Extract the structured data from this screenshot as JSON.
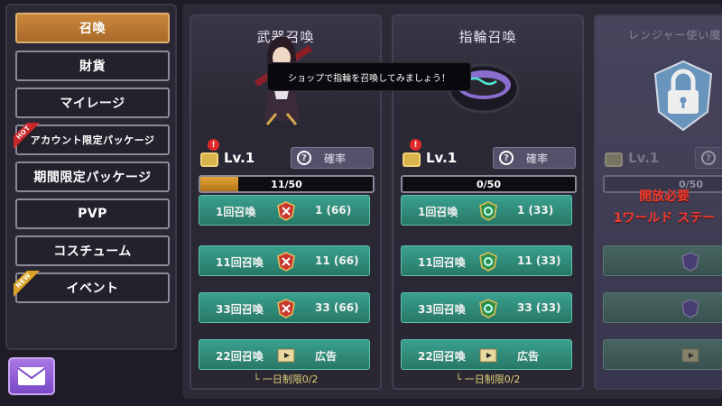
{
  "sidebar": {
    "items": [
      {
        "label": "召喚",
        "active": true
      },
      {
        "label": "財貨"
      },
      {
        "label": "マイレージ"
      },
      {
        "label": "アカウント限定パッケージ",
        "badge": "HOT"
      },
      {
        "label": "期間限定パッケージ"
      },
      {
        "label": "PVP"
      },
      {
        "label": "コスチューム"
      },
      {
        "label": "イベント",
        "badge": "NEW"
      }
    ]
  },
  "mail": {
    "icon": "mail-icon"
  },
  "tooltip": {
    "text": "ショップで指輪を召喚してみましょう！"
  },
  "cards": [
    {
      "title": "武器召喚",
      "level": "Lv.1",
      "rate_label": "確率",
      "progress_text": "11/50",
      "progress_fraction": 0.22,
      "buttons": [
        {
          "label": "1回召喚",
          "cost": "1 (66)",
          "icon": "sword-gem-icon"
        },
        {
          "label": "11回召喚",
          "cost": "11 (66)",
          "icon": "sword-gem-icon"
        },
        {
          "label": "33回召喚",
          "cost": "33 (66)",
          "icon": "sword-gem-icon"
        },
        {
          "label": "22回召喚",
          "cost": "広告",
          "icon": "video-ad-icon"
        }
      ],
      "limit": "└ 一日制限0/2"
    },
    {
      "title": "指輪召喚",
      "level": "Lv.1",
      "rate_label": "確率",
      "progress_text": "0/50",
      "progress_fraction": 0,
      "buttons": [
        {
          "label": "1回召喚",
          "cost": "1 (33)",
          "icon": "ring-gem-icon"
        },
        {
          "label": "11回召喚",
          "cost": "11 (33)",
          "icon": "ring-gem-icon"
        },
        {
          "label": "33回召喚",
          "cost": "33 (33)",
          "icon": "ring-gem-icon"
        },
        {
          "label": "22回召喚",
          "cost": "広告",
          "icon": "video-ad-icon"
        }
      ],
      "limit": "└ 一日制限0/2"
    },
    {
      "title": "レンジャー使い魔",
      "level": "Lv.1",
      "progress_text": "0/50",
      "unlock_line1": "開放必要",
      "unlock_line2": "1ワールド ステー",
      "locked": true
    }
  ],
  "colors": {
    "accent_orange": "#c9883a",
    "summon_green": "#2f8a78",
    "unlock_red": "#ff3e2f"
  }
}
